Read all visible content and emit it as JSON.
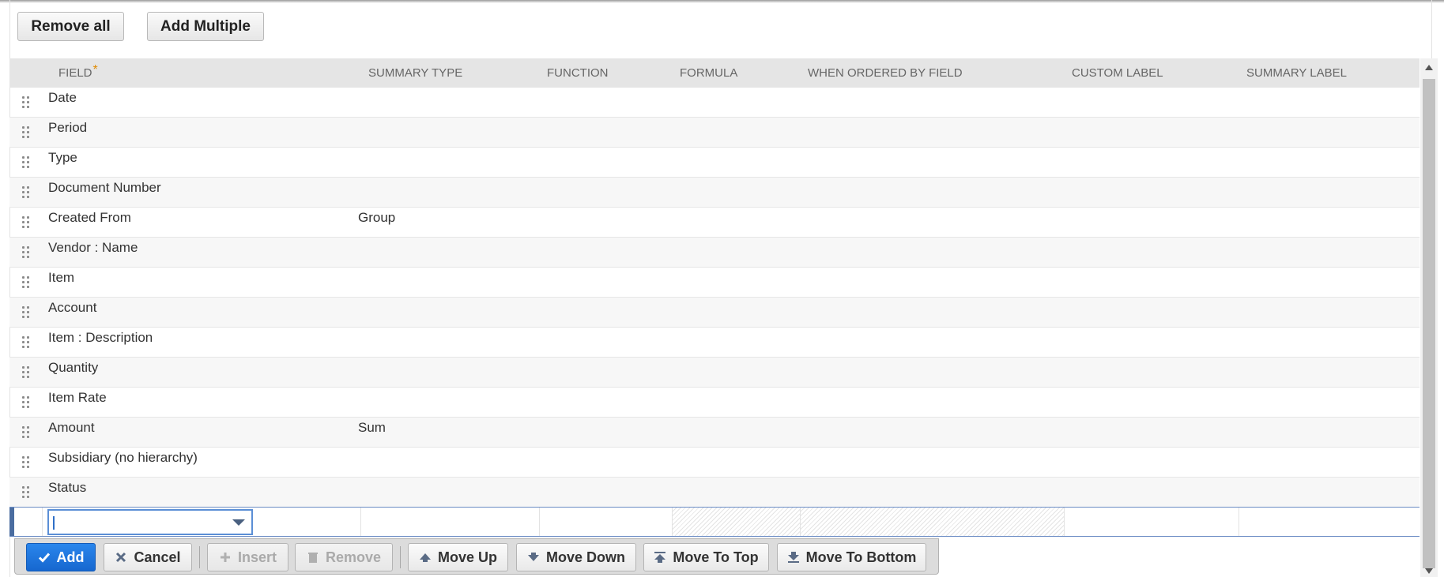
{
  "top_buttons": {
    "remove_all": "Remove all",
    "add_multiple": "Add Multiple"
  },
  "columns": {
    "field": "FIELD",
    "field_required_marker": "*",
    "summary_type": "SUMMARY TYPE",
    "function": "FUNCTION",
    "formula": "FORMULA",
    "when_ordered_by_field": "WHEN ORDERED BY FIELD",
    "custom_label": "CUSTOM LABEL",
    "summary_label": "SUMMARY LABEL"
  },
  "rows": [
    {
      "field": "Date",
      "summary_type": ""
    },
    {
      "field": "Period",
      "summary_type": ""
    },
    {
      "field": "Type",
      "summary_type": ""
    },
    {
      "field": "Document Number",
      "summary_type": ""
    },
    {
      "field": "Created From",
      "summary_type": "Group"
    },
    {
      "field": "Vendor : Name",
      "summary_type": ""
    },
    {
      "field": "Item",
      "summary_type": ""
    },
    {
      "field": "Account",
      "summary_type": ""
    },
    {
      "field": "Item : Description",
      "summary_type": ""
    },
    {
      "field": "Quantity",
      "summary_type": ""
    },
    {
      "field": "Item Rate",
      "summary_type": ""
    },
    {
      "field": "Amount",
      "summary_type": "Sum"
    },
    {
      "field": "Subsidiary (no hierarchy)",
      "summary_type": ""
    },
    {
      "field": "Status",
      "summary_type": ""
    }
  ],
  "edit_row": {
    "field_value": ""
  },
  "toolbar": {
    "add": "Add",
    "cancel": "Cancel",
    "insert": "Insert",
    "remove": "Remove",
    "move_up": "Move Up",
    "move_down": "Move Down",
    "move_to_top": "Move To Top",
    "move_to_bottom": "Move To Bottom"
  },
  "colors": {
    "primary": "#1a73e0",
    "required": "#e08a00",
    "header_bg": "#e5e5e5"
  }
}
